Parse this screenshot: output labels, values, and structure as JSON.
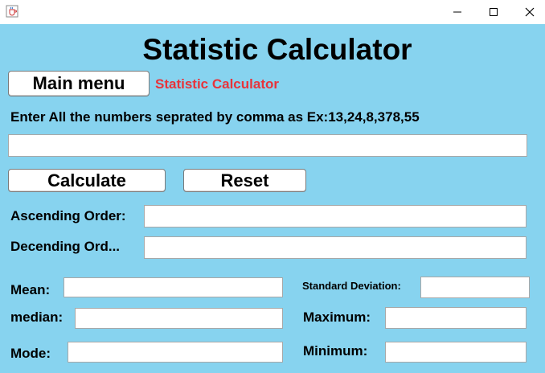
{
  "window": {
    "icon": "java-cup-icon"
  },
  "app": {
    "heading": "Statistic Calculator",
    "main_menu_label": "Main menu",
    "current_screen": "Statistic Calculator",
    "instruction": "Enter All the numbers seprated by comma as Ex:13,24,8,378,55",
    "numbers_value": "",
    "calculate_label": "Calculate",
    "reset_label": "Reset",
    "ascending_label": "Ascending Order:",
    "ascending_value": "",
    "descending_label": "Decending Ord...",
    "descending_value": "",
    "mean_label": "Mean:",
    "mean_value": "",
    "median_label": "median:",
    "median_value": "",
    "mode_label": "Mode:",
    "mode_value": "",
    "stddev_label": "Standard Deviation:",
    "stddev_value": "",
    "maximum_label": "Maximum:",
    "maximum_value": "",
    "minimum_label": "Minimum:",
    "minimum_value": ""
  },
  "colors": {
    "panel_bg": "#87d3ef",
    "accent_red": "#e8333a"
  }
}
